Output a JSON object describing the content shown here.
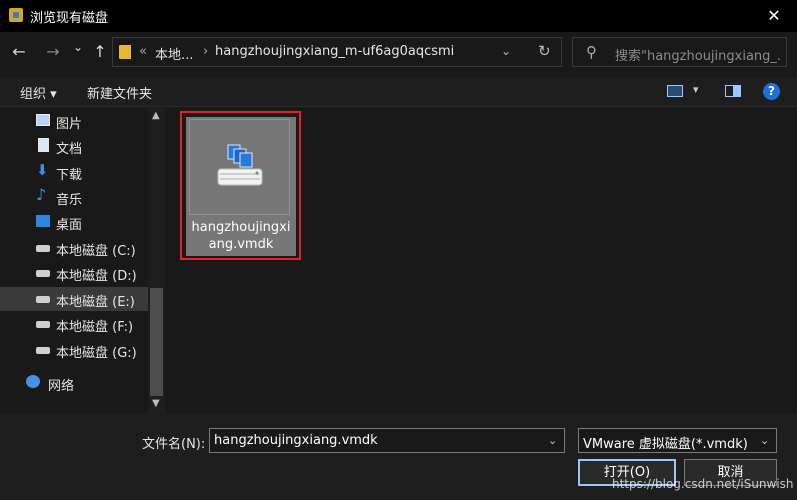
{
  "window": {
    "title": "浏览现有磁盘",
    "close_glyph": "✕"
  },
  "nav": {
    "back": "←",
    "forward": "→",
    "up_dropdown": "⌄",
    "up": "↑",
    "breadcrumb_sep_left": "«",
    "crumb1": "本地...",
    "crumb_sep": "›",
    "crumb2": "hangzhoujingxiang_m-uf6ag0aqcsmi...",
    "address_dropdown": "⌄",
    "refresh": "↻",
    "search_placeholder": "搜索\"hangzhoujingxiang_...",
    "search_glyph": "⚲"
  },
  "toolbar": {
    "organize": "组织 ▾",
    "new_folder": "新建文件夹",
    "view_dropdown": "▾",
    "help": "?"
  },
  "sidebar": {
    "items": [
      {
        "label": "图片",
        "icon": "pictures-icon"
      },
      {
        "label": "文档",
        "icon": "documents-icon"
      },
      {
        "label": "下载",
        "icon": "download-icon"
      },
      {
        "label": "音乐",
        "icon": "music-icon"
      },
      {
        "label": "桌面",
        "icon": "desktop-icon"
      },
      {
        "label": "本地磁盘 (C:)",
        "icon": "system-drive-icon"
      },
      {
        "label": "本地磁盘 (D:)",
        "icon": "drive-icon"
      },
      {
        "label": "本地磁盘 (E:)",
        "icon": "drive-icon",
        "selected": true
      },
      {
        "label": "本地磁盘 (F:)",
        "icon": "drive-icon"
      },
      {
        "label": "本地磁盘 (G:)",
        "icon": "drive-icon"
      },
      {
        "label": "网络",
        "icon": "network-icon"
      }
    ],
    "scroll_up": "▲",
    "scroll_down": "▼"
  },
  "files": [
    {
      "name_line1": "hangzhoujingxi",
      "name_line2": "ang.vmdk",
      "icon": "vmware-disk-icon"
    }
  ],
  "footer": {
    "filename_label": "文件名(N):",
    "filename_value": "hangzhoujingxiang.vmdk",
    "filetype_value": "VMware 虚拟磁盘(*.vmdk)",
    "dropdown_glyph": "⌄",
    "open": "打开(O)",
    "cancel": "取消"
  },
  "watermark": "https://blog.csdn.net/iSunwish",
  "colors": {
    "highlight_border": "#e0232b",
    "accent": "#1e6fd9"
  }
}
